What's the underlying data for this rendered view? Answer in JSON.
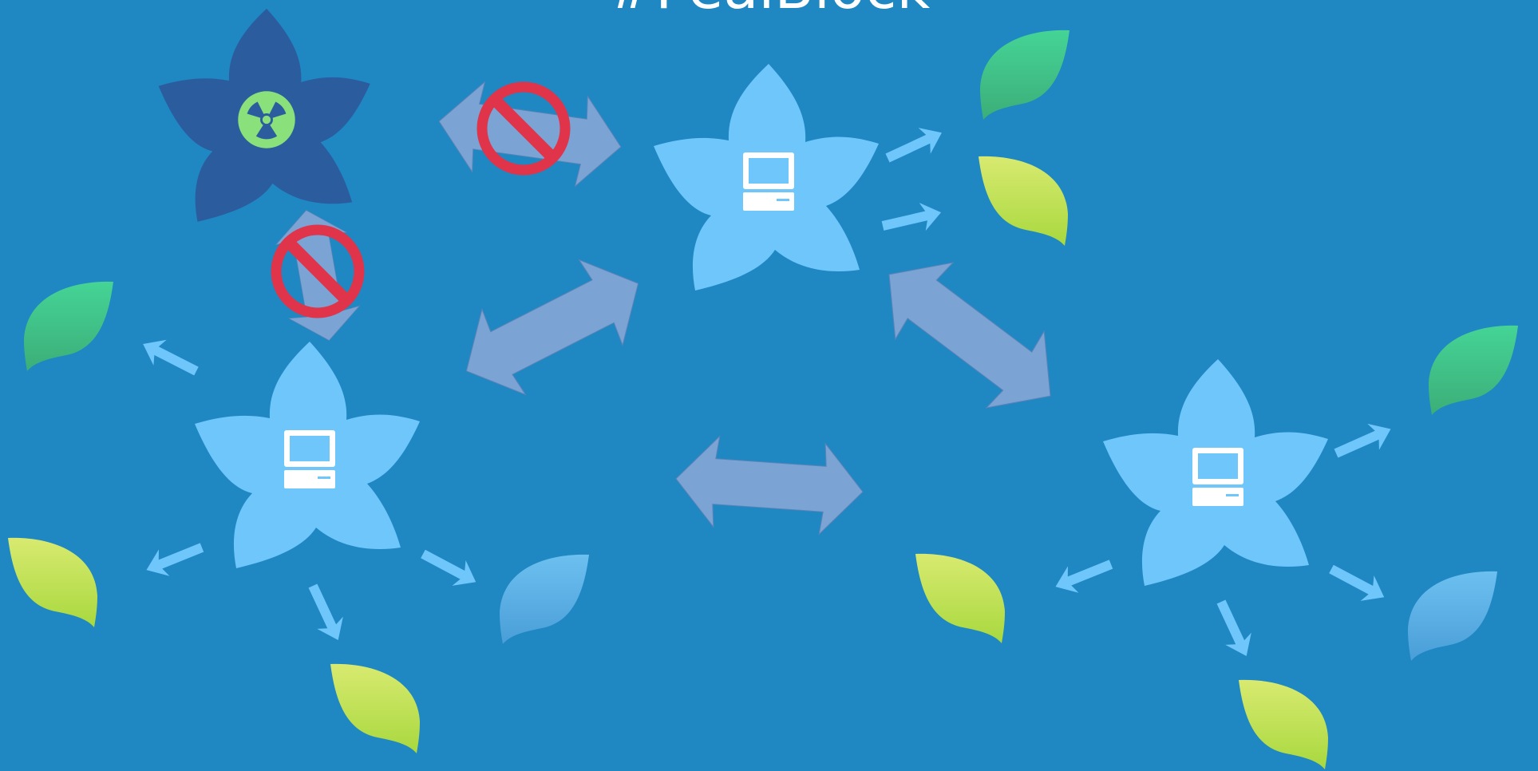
{
  "title": "#PealBlock",
  "colors": {
    "background": "#1f87c2",
    "peer_node": "#6ec6fb",
    "blocked_node": "#2b5d9e",
    "hazard_badge": "#8ae07a",
    "connection_arrow": "#7ba3d4",
    "share_arrow": "#6ec6fb",
    "block_sign": "#e0344a",
    "leaf_green": "#41cc8a",
    "leaf_lime": "#b8e04a",
    "leaf_blue": "#5fb0e6"
  },
  "nodes": [
    {
      "id": "blocked-peer",
      "kind": "blocked",
      "icon": "radiation-icon"
    },
    {
      "id": "peer-top",
      "kind": "peer",
      "icon": "computer-icon"
    },
    {
      "id": "peer-left",
      "kind": "peer",
      "icon": "computer-icon"
    },
    {
      "id": "peer-right",
      "kind": "peer",
      "icon": "computer-icon"
    }
  ],
  "connections": [
    {
      "from": "blocked-peer",
      "to": "peer-top",
      "status": "blocked",
      "icon": "no-entry-icon"
    },
    {
      "from": "blocked-peer",
      "to": "peer-left",
      "status": "blocked",
      "icon": "no-entry-icon"
    },
    {
      "from": "peer-left",
      "to": "peer-top",
      "status": "open"
    },
    {
      "from": "peer-top",
      "to": "peer-right",
      "status": "open"
    },
    {
      "from": "peer-left",
      "to": "peer-right",
      "status": "open"
    }
  ],
  "leaves": [
    {
      "owner": "peer-top",
      "variant": "green"
    },
    {
      "owner": "peer-top",
      "variant": "lime"
    },
    {
      "owner": "peer-left",
      "variant": "green"
    },
    {
      "owner": "peer-left",
      "variant": "lime"
    },
    {
      "owner": "peer-left",
      "variant": "lime"
    },
    {
      "owner": "peer-left",
      "variant": "blue"
    },
    {
      "owner": "peer-right",
      "variant": "green"
    },
    {
      "owner": "peer-right",
      "variant": "lime"
    },
    {
      "owner": "peer-right",
      "variant": "lime"
    },
    {
      "owner": "peer-right",
      "variant": "blue"
    }
  ]
}
